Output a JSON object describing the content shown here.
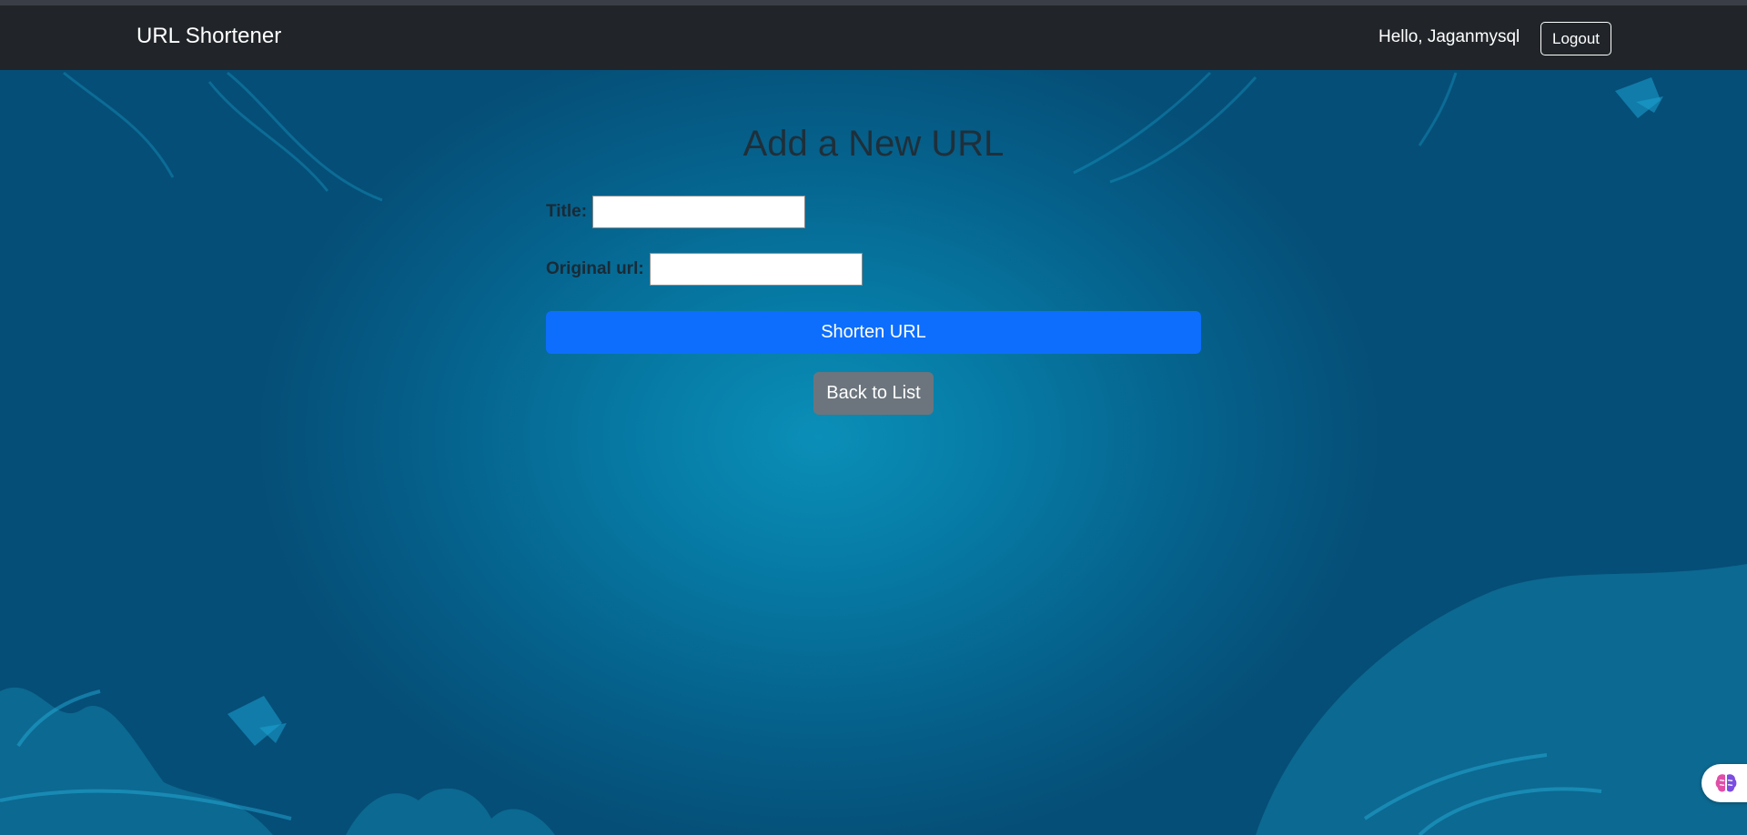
{
  "navbar": {
    "brand": "URL Shortener",
    "greeting": "Hello, Jaganmysql",
    "logout_label": "Logout"
  },
  "form": {
    "heading": "Add a New URL",
    "title_label": "Title:",
    "title_value": "",
    "original_url_label": "Original url:",
    "original_url_value": "",
    "submit_label": "Shorten URL",
    "back_label": "Back to List"
  },
  "colors": {
    "navbar_bg": "#212529",
    "primary_button": "#0d6efd",
    "secondary_button": "#6c757d",
    "page_background": "#05608a"
  },
  "icons": {
    "extension_widget": "brain-icon"
  }
}
